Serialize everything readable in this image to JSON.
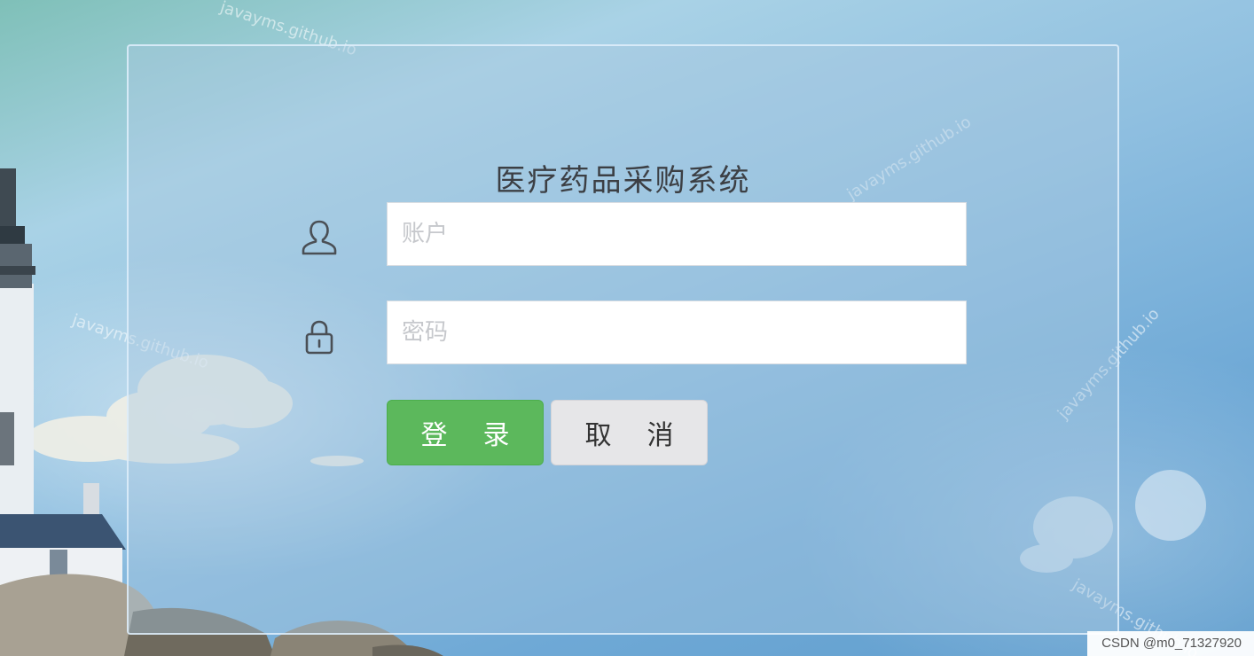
{
  "login": {
    "title": "医疗药品采购系统",
    "account_placeholder": "账户",
    "password_placeholder": "密码",
    "login_chars": [
      "登",
      "录"
    ],
    "cancel_chars": [
      "取",
      "消"
    ]
  },
  "icons": {
    "account": "user-icon",
    "password": "lock-icon"
  },
  "watermarks": [
    "javayms.github.io",
    "javayms.github.io",
    "javayms.github.io",
    "javayms.github.io",
    "javayms.github.io"
  ],
  "footer": {
    "csdn_label": "CSDN @m0_71327920"
  },
  "colors": {
    "login_button": "#5cb85c",
    "cancel_button": "#e6e6e8",
    "title_text": "#3c3f44"
  }
}
